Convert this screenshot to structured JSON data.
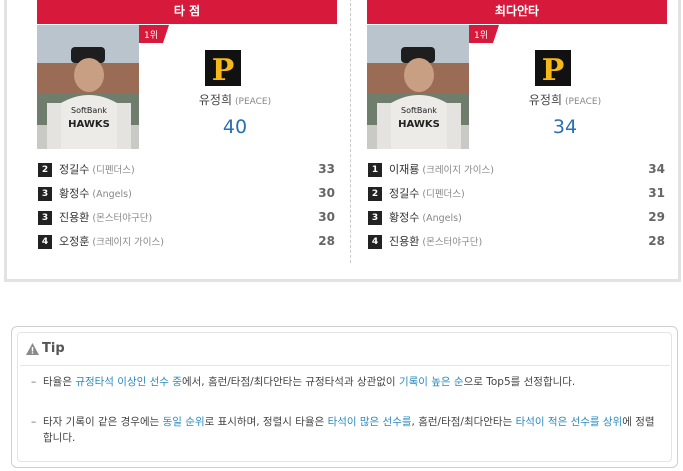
{
  "colors": {
    "header_red": "#d7193b",
    "value_blue": "#2a6fb0",
    "link_blue": "#2a8bbf"
  },
  "panels": [
    {
      "title": "타 점",
      "rank_badge": "1위",
      "logo_icon": "pirates-p-logo-icon",
      "top": {
        "name": "유정희",
        "team": "(PEACE)",
        "value": "40"
      },
      "list": [
        {
          "rank": "2",
          "name": "정길수",
          "team": "(디펜더스)",
          "value": "33"
        },
        {
          "rank": "3",
          "name": "황정수",
          "team": "(Angels)",
          "value": "30"
        },
        {
          "rank": "3",
          "name": "진용환",
          "team": "(몬스터야구단)",
          "value": "30"
        },
        {
          "rank": "4",
          "name": "오정훈",
          "team": "(크레이지 가이스)",
          "value": "28"
        }
      ]
    },
    {
      "title": "최다안타",
      "rank_badge": "1위",
      "logo_icon": "pirates-p-logo-icon",
      "top": {
        "name": "유정희",
        "team": "(PEACE)",
        "value": "34"
      },
      "list": [
        {
          "rank": "1",
          "name": "이재룡",
          "team": "(크레이지 가이스)",
          "value": "34"
        },
        {
          "rank": "2",
          "name": "정길수",
          "team": "(디펜더스)",
          "value": "31"
        },
        {
          "rank": "3",
          "name": "황정수",
          "team": "(Angels)",
          "value": "29"
        },
        {
          "rank": "4",
          "name": "진용환",
          "team": "(몬스터야구단)",
          "value": "28"
        }
      ]
    }
  ],
  "photo_jersey_text": [
    "SoftBank",
    "HAWKS"
  ],
  "tip": {
    "title": "Tip",
    "items": [
      [
        {
          "t": "타율",
          "c": ""
        },
        {
          "t": "은 ",
          "c": ""
        },
        {
          "t": "규정타석 이상인 선수 중",
          "c": "blue"
        },
        {
          "t": "에서, ",
          "c": ""
        },
        {
          "t": "홈런/타점/최다안타",
          "c": ""
        },
        {
          "t": "는 규정타석과 상관없이 ",
          "c": ""
        },
        {
          "t": "기록이 높은 순",
          "c": "blue"
        },
        {
          "t": "으로 Top5를 선정합니다.",
          "c": ""
        }
      ],
      [
        {
          "t": "타자 기록이 같은 경우",
          "c": ""
        },
        {
          "t": "에는 ",
          "c": ""
        },
        {
          "t": "동일 순위",
          "c": "blue"
        },
        {
          "t": "로 표시하며, 정렬시 ",
          "c": ""
        },
        {
          "t": "타율",
          "c": ""
        },
        {
          "t": "은 ",
          "c": ""
        },
        {
          "t": "타석이 많은 선수를",
          "c": "blue"
        },
        {
          "t": ", ",
          "c": ""
        },
        {
          "t": "홈런/타점/최다안타",
          "c": ""
        },
        {
          "t": "는 ",
          "c": ""
        },
        {
          "t": "타석이 적은 선수를 상위",
          "c": "blue"
        },
        {
          "t": "에 정렬합니다.",
          "c": ""
        }
      ]
    ]
  }
}
